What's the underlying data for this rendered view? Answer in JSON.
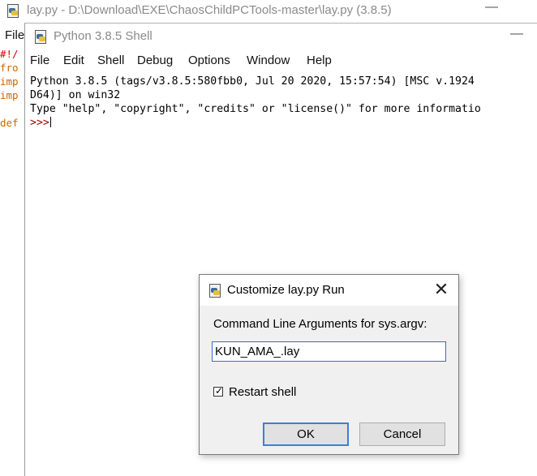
{
  "editor": {
    "title": "lay.py - D:\\Download\\EXE\\ChaosChildPCTools-master\\lay.py (3.8.5)",
    "minimize_glyph": "—",
    "menu": {
      "file": "File"
    },
    "code_lines": [
      "#!/",
      "fro",
      "imp",
      "imp",
      "",
      "def"
    ]
  },
  "shell": {
    "title": "Python 3.8.5 Shell",
    "minimize_glyph": "—",
    "menu": [
      "File",
      "Edit",
      "Shell",
      "Debug",
      "Options",
      "Window",
      "Help"
    ],
    "output_lines": [
      "Python 3.8.5 (tags/v3.8.5:580fbb0, Jul 20 2020, 15:57:54) [MSC v.1924",
      "D64)] on win32",
      "Type \"help\", \"copyright\", \"credits\" or \"license()\" for more informatio"
    ],
    "prompt": ">>>"
  },
  "dialog": {
    "title": "Customize lay.py Run",
    "close_glyph": "✕",
    "prompt_label": "Command Line Arguments for sys.argv:",
    "args_value": "KUN_AMA_.lay",
    "restart_label": "Restart shell",
    "restart_checked": true,
    "ok_label": "OK",
    "cancel_label": "Cancel"
  }
}
